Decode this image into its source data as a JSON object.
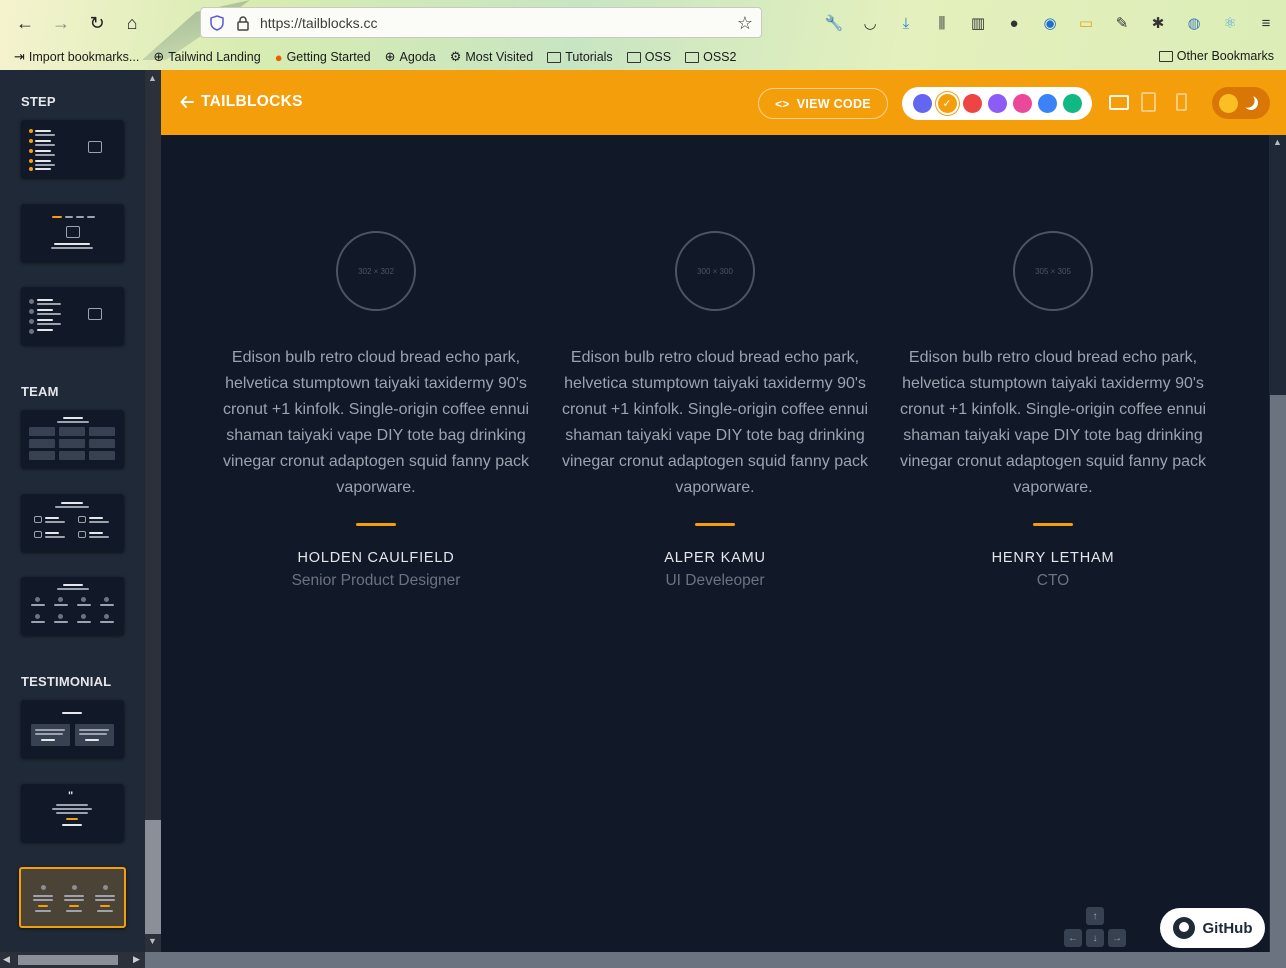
{
  "browser": {
    "url": "https://tailblocks.cc",
    "bookmarks": [
      "Import bookmarks...",
      "Tailwind Landing",
      "Getting Started",
      "Agoda",
      "Most Visited",
      "Tutorials",
      "OSS",
      "OSS2"
    ],
    "other_bookmarks": "Other Bookmarks"
  },
  "sidebar": {
    "sections": [
      {
        "title": "STEP"
      },
      {
        "title": "TEAM"
      },
      {
        "title": "TESTIMONIAL"
      }
    ]
  },
  "header": {
    "brand": "TAILBLOCKS",
    "view_code": "VIEW CODE",
    "colors": [
      "#6366f1",
      "#f59e0b",
      "#ef4444",
      "#8b5cf6",
      "#ec4899",
      "#3b82f6",
      "#10b981"
    ],
    "selected_color": "#f59e0b"
  },
  "testimonials": [
    {
      "avatar_label": "302 × 302",
      "quote": "Edison bulb retro cloud bread echo park, helvetica stumptown taiyaki taxidermy 90's cronut +1 kinfolk. Single-origin coffee ennui shaman taiyaki vape DIY tote bag drinking vinegar cronut adaptogen squid fanny pack vaporware.",
      "name": "HOLDEN CAULFIELD",
      "role": "Senior Product Designer"
    },
    {
      "avatar_label": "300 × 300",
      "quote": "Edison bulb retro cloud bread echo park, helvetica stumptown taiyaki taxidermy 90's cronut +1 kinfolk. Single-origin coffee ennui shaman taiyaki vape DIY tote bag drinking vinegar cronut adaptogen squid fanny pack vaporware.",
      "name": "ALPER KAMU",
      "role": "UI Develeoper"
    },
    {
      "avatar_label": "305 × 305",
      "quote": "Edison bulb retro cloud bread echo park, helvetica stumptown taiyaki taxidermy 90's cronut +1 kinfolk. Single-origin coffee ennui shaman taiyaki vape DIY tote bag drinking vinegar cronut adaptogen squid fanny pack vaporware.",
      "name": "HENRY LETHAM",
      "role": "CTO"
    }
  ],
  "github_button": "GitHub"
}
